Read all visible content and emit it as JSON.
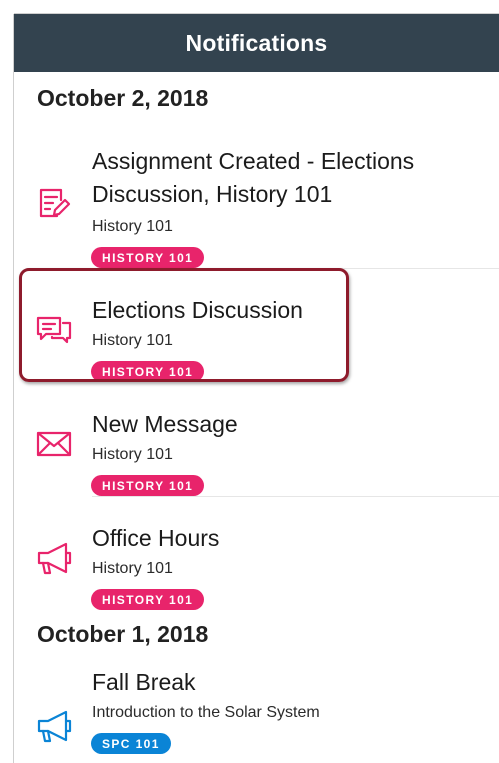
{
  "header": {
    "title": "Notifications"
  },
  "colors": {
    "navbar": "#33434f",
    "pink_accent": "#e8246b",
    "blue_accent": "#0a84d6",
    "highlight": "#8e1b2c"
  },
  "sections": [
    {
      "date": "October 2, 2018",
      "items": [
        {
          "icon": "assignment-icon",
          "title": "Assignment Created - Elections Discussion, History 101",
          "subtitle": "History 101",
          "badge": "HISTORY 101"
        },
        {
          "icon": "discussion-icon",
          "title": "Elections Discussion",
          "subtitle": "History 101",
          "badge": "HISTORY 101"
        },
        {
          "icon": "message-icon",
          "title": "New Message",
          "subtitle": "History 101",
          "badge": "HISTORY 101"
        },
        {
          "icon": "announcement-icon",
          "title": "Office Hours",
          "subtitle": "History 101",
          "badge": "HISTORY 101"
        }
      ]
    },
    {
      "date": "October 1, 2018",
      "items": [
        {
          "icon": "announcement-icon",
          "title": "Fall Break",
          "subtitle": "Introduction to the Solar System",
          "badge": "SPC 101"
        }
      ]
    }
  ]
}
